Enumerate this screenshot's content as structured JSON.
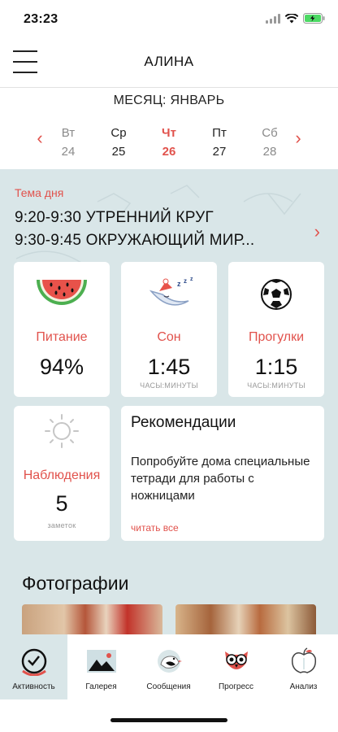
{
  "status_bar": {
    "time": "23:23"
  },
  "header": {
    "title": "АЛИНА"
  },
  "month": {
    "label": "МЕСЯЦ:  ЯНВАРЬ"
  },
  "week": {
    "days": [
      {
        "name": "Вт",
        "num": "24"
      },
      {
        "name": "Ср",
        "num": "25"
      },
      {
        "name": "Чт",
        "num": "26"
      },
      {
        "name": "Пт",
        "num": "27"
      },
      {
        "name": "Сб",
        "num": "28"
      }
    ]
  },
  "theme": {
    "label": "Тема дня",
    "lines": [
      "9:20-9:30 УТРЕННИЙ КРУГ",
      "9:30-9:45 ОКРУЖАЮЩИЙ МИР..."
    ]
  },
  "cards": {
    "food": {
      "title": "Питание",
      "value": "94%"
    },
    "sleep": {
      "title": "Сон",
      "value": "1:45",
      "sub": "ЧАСЫ:МИНУТЫ"
    },
    "walks": {
      "title": "Прогулки",
      "value": "1:15",
      "sub": "ЧАСЫ:МИНУТЫ"
    },
    "observations": {
      "title": "Наблюдения",
      "value": "5",
      "sub": "заметок"
    }
  },
  "recommendations": {
    "title": "Рекомендации",
    "text": "Попробуйте дома специальные тетради для работы с ножницами",
    "link": "читать все"
  },
  "photos": {
    "title": "Фотографии"
  },
  "tabs": [
    {
      "label": "Активность",
      "icon": "activity-icon"
    },
    {
      "label": "Галерея",
      "icon": "gallery-icon"
    },
    {
      "label": "Сообщения",
      "icon": "bird-icon"
    },
    {
      "label": "Прогресс",
      "icon": "owl-icon"
    },
    {
      "label": "Анализ",
      "icon": "apple-icon"
    }
  ],
  "colors": {
    "accent": "#e1524c",
    "panel_bg": "#d9e6e8"
  }
}
